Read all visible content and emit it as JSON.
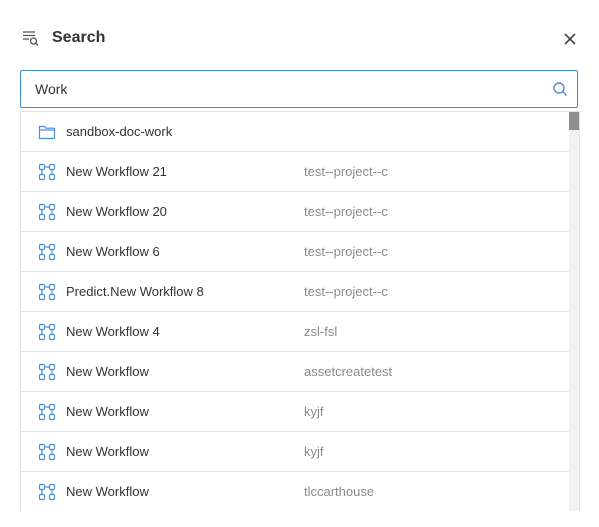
{
  "header": {
    "title": "Search",
    "icon": "search-filter-icon",
    "close_icon": "close-icon"
  },
  "search": {
    "value": "Work",
    "icon": "search-icon"
  },
  "colors": {
    "accent": "#3b8ed4",
    "icon": "#4a8fd6",
    "border": "#e3e3e3",
    "secondary_text": "#8a8a8a"
  },
  "results": [
    {
      "type": "folder",
      "icon": "folder-icon",
      "name": "sandbox-doc-work",
      "project": ""
    },
    {
      "type": "workflow",
      "icon": "workflow-icon",
      "name": "New Workflow 21",
      "project": "test--project--c"
    },
    {
      "type": "workflow",
      "icon": "workflow-icon",
      "name": "New Workflow 20",
      "project": "test--project--c"
    },
    {
      "type": "workflow",
      "icon": "workflow-icon",
      "name": "New Workflow 6",
      "project": "test--project--c"
    },
    {
      "type": "workflow",
      "icon": "workflow-icon",
      "name": "Predict.New Workflow 8",
      "project": "test--project--c"
    },
    {
      "type": "workflow",
      "icon": "workflow-icon",
      "name": "New Workflow 4",
      "project": "zsl-fsl"
    },
    {
      "type": "workflow",
      "icon": "workflow-icon",
      "name": "New Workflow",
      "project": "assetcreatetest"
    },
    {
      "type": "workflow",
      "icon": "workflow-icon",
      "name": "New Workflow",
      "project": "kyjf"
    },
    {
      "type": "workflow",
      "icon": "workflow-icon",
      "name": "New Workflow",
      "project": "kyjf"
    },
    {
      "type": "workflow",
      "icon": "workflow-icon",
      "name": "New Workflow",
      "project": "tlccarthouse"
    }
  ]
}
